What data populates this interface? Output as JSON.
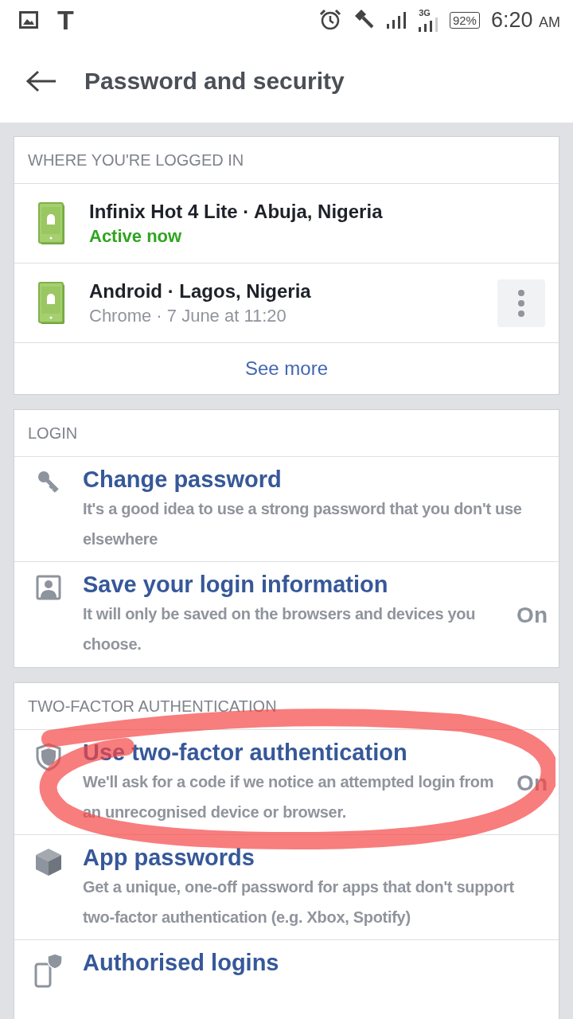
{
  "status_bar": {
    "text_glyph": "T",
    "network": "3G",
    "battery": "92%",
    "time": "6:20",
    "period": "AM"
  },
  "header": {
    "title": "Password and security"
  },
  "sessions": {
    "heading": "WHERE YOU'RE LOGGED IN",
    "items": [
      {
        "device": "Infinix Hot 4 Lite · Abuja, Nigeria",
        "detail": "Active now",
        "active": true,
        "menu": false
      },
      {
        "device": "Android · Lagos, Nigeria",
        "detail": "Chrome · 7 June at 11:20",
        "active": false,
        "menu": true
      }
    ],
    "more": "See more"
  },
  "sections": [
    {
      "heading": "LOGIN",
      "items": [
        {
          "title": "Change password",
          "description": "It's a good idea to use a strong password that you don't use elsewhere"
        },
        {
          "title": "Save your login information",
          "description": "It will only be saved on the browsers and devices you choose.",
          "status": "On"
        }
      ]
    },
    {
      "heading": "TWO-FACTOR AUTHENTICATION",
      "annotated": true,
      "items": [
        {
          "title": "Use two-factor authentication",
          "description": "We'll ask for a code if we notice an attempted login from an unrecognised device or browser.",
          "status": "On"
        },
        {
          "title": "App passwords",
          "description": "Get a unique, one-off password for apps that don't support two-factor authentication (e.g. Xbox, Spotify)"
        },
        {
          "title": "Authorised logins"
        }
      ]
    }
  ]
}
